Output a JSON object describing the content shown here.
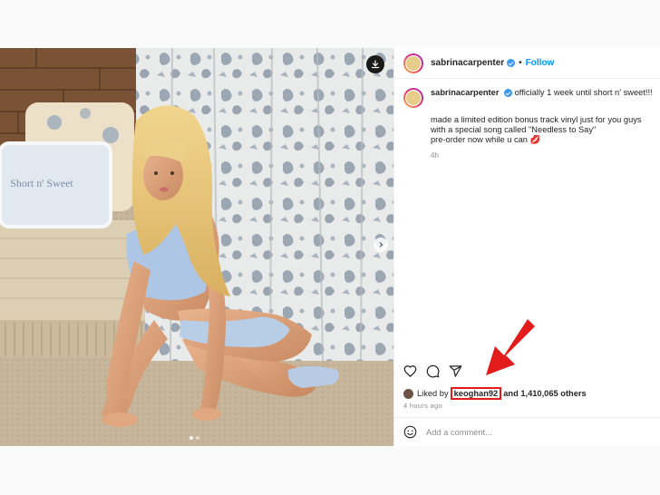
{
  "post": {
    "username": "sabrinacarpenter",
    "follow_label": "Follow",
    "separator": "•",
    "caption_line1": "officially 1 week until short n' sweet!!!",
    "caption_line2": "made a limited edition bonus track vinyl just for you guys with a special song called \"Needless to Say\"",
    "caption_line3": "pre-order now while u can 💋",
    "caption_time": "4h",
    "pillow_text": "Short n' Sweet",
    "liked_prefix": "Liked by",
    "liked_user": "keoghan92",
    "liked_suffix": "and 1,410,065 others",
    "posted_time": "4 hours ago",
    "comment_placeholder": "Add a comment...",
    "carousel_dots": 2,
    "active_dot": 0
  },
  "icons": {
    "download": "download-icon",
    "next": "chevron-right-icon",
    "like": "heart-icon",
    "comment": "comment-icon",
    "share": "share-icon",
    "emoji": "emoji-icon",
    "annotation": "red-arrow-icon"
  },
  "colors": {
    "link": "#0095f6",
    "verified": "#3897f0",
    "highlight": "#e21b1b"
  }
}
